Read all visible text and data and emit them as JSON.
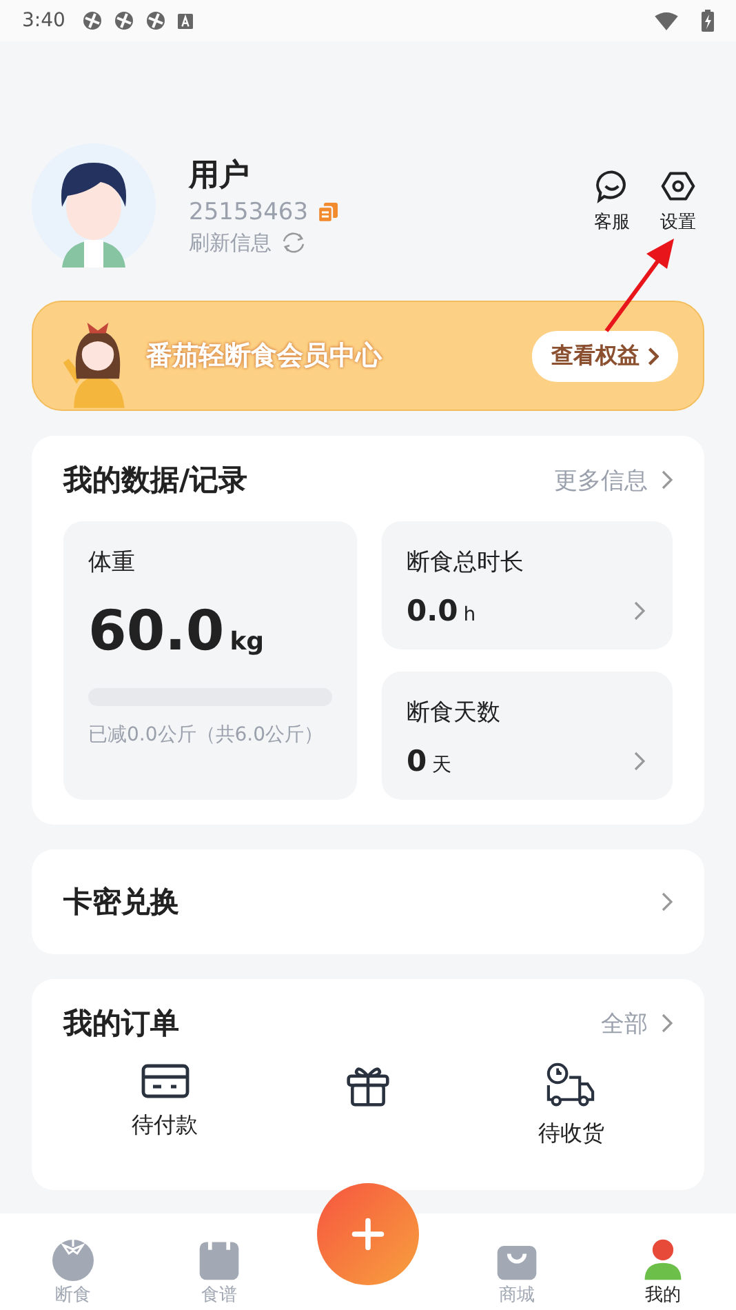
{
  "status_bar": {
    "time": "3:40"
  },
  "profile": {
    "name": "用户",
    "id": "25153463",
    "refresh": "刷新信息"
  },
  "top_actions": [
    {
      "kind": "chat",
      "label": "客服"
    },
    {
      "kind": "settings",
      "label": "设置"
    }
  ],
  "banner": {
    "title": "番茄轻断食会员中心",
    "button": "查看权益"
  },
  "data_card": {
    "title": "我的数据/记录",
    "more": "更多信息",
    "weight": {
      "label": "体重",
      "value": "60.0",
      "unit": "kg",
      "note": "已减0.0公斤（共6.0公斤）"
    },
    "stats": [
      {
        "label": "断食总时长",
        "value": "0.0",
        "unit": "h"
      },
      {
        "label": "断食天数",
        "value": "0",
        "unit": "天"
      }
    ]
  },
  "redeem": {
    "title": "卡密兑换"
  },
  "orders": {
    "title": "我的订单",
    "more": "全部",
    "items": [
      {
        "kind": "card",
        "label": "待付款"
      },
      {
        "kind": "gift"
      },
      {
        "kind": "truck",
        "label": "待收货"
      }
    ]
  },
  "tab_bar": [
    {
      "kind": "tomato",
      "label": "断食",
      "selected": false
    },
    {
      "kind": "calendar",
      "label": "食谱",
      "selected": false
    },
    {
      "kind": "add",
      "selected": false
    },
    {
      "kind": "shop",
      "label": "商城",
      "selected": false
    },
    {
      "kind": "person",
      "label": "我的",
      "selected": true
    }
  ]
}
